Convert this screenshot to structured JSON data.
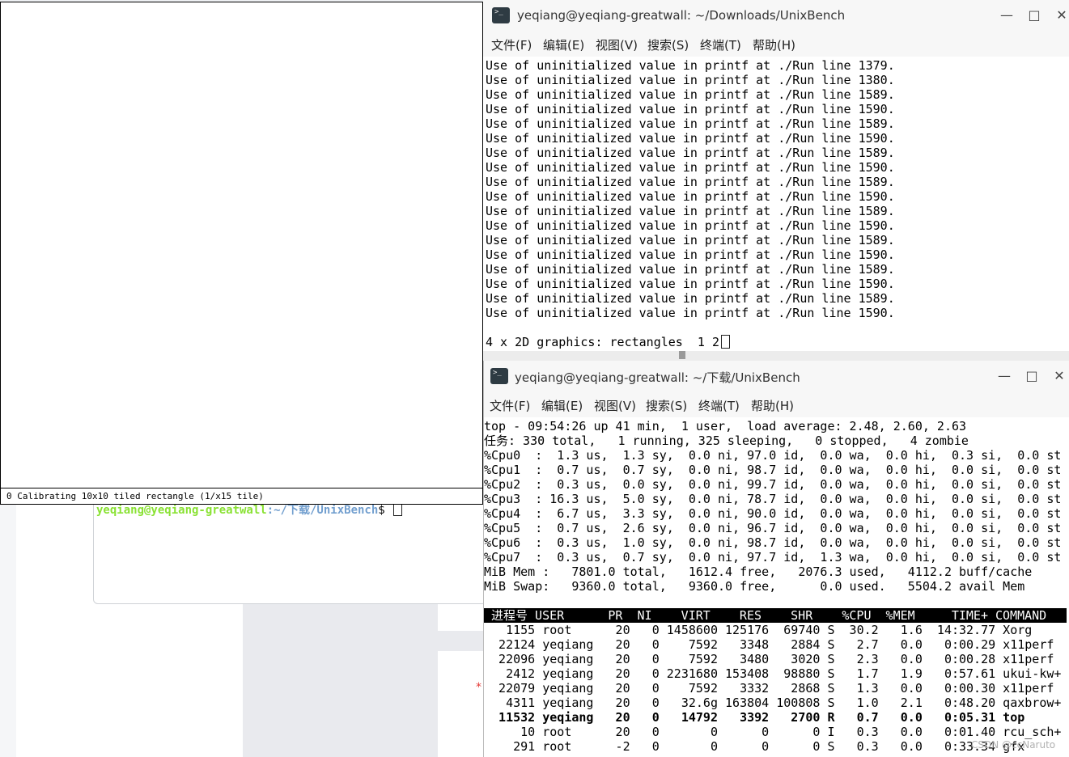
{
  "small_terminal": {
    "prompt_user": "yeqiang@yeqiang-greatwall",
    "prompt_path": ":~/下载/UnixBench",
    "prompt_symbol": "$ "
  },
  "x11perf": {
    "status_text": "0 Calibrating 10x10 tiled rectangle (1/x15 tile)"
  },
  "terminal_top": {
    "title": "yeqiang@yeqiang-greatwall: ~/Downloads/UnixBench",
    "menu": [
      "文件(F)",
      "编辑(E)",
      "视图(V)",
      "搜索(S)",
      "终端(T)",
      "帮助(H)"
    ],
    "lines": [
      "Use of uninitialized value in printf at ./Run line 1379.",
      "Use of uninitialized value in printf at ./Run line 1380.",
      "Use of uninitialized value in printf at ./Run line 1589.",
      "Use of uninitialized value in printf at ./Run line 1590.",
      "Use of uninitialized value in printf at ./Run line 1589.",
      "Use of uninitialized value in printf at ./Run line 1590.",
      "Use of uninitialized value in printf at ./Run line 1589.",
      "Use of uninitialized value in printf at ./Run line 1590.",
      "Use of uninitialized value in printf at ./Run line 1589.",
      "Use of uninitialized value in printf at ./Run line 1590.",
      "Use of uninitialized value in printf at ./Run line 1589.",
      "Use of uninitialized value in printf at ./Run line 1590.",
      "Use of uninitialized value in printf at ./Run line 1589.",
      "Use of uninitialized value in printf at ./Run line 1590.",
      "Use of uninitialized value in printf at ./Run line 1589.",
      "Use of uninitialized value in printf at ./Run line 1590.",
      "Use of uninitialized value in printf at ./Run line 1589.",
      "Use of uninitialized value in printf at ./Run line 1590.",
      "",
      "4 x 2D graphics: rectangles  1 2"
    ]
  },
  "terminal_bottom": {
    "title": "yeqiang@yeqiang-greatwall: ~/下载/UnixBench",
    "menu": [
      "文件(F)",
      "编辑(E)",
      "视图(V)",
      "搜索(S)",
      "终端(T)",
      "帮助(H)"
    ],
    "summary": [
      "top - 09:54:26 up 41 min,  1 user,  load average: 2.48, 2.60, 2.63",
      "任务: 330 total,   1 running, 325 sleeping,   0 stopped,   4 zombie",
      "%Cpu0  :  1.3 us,  1.3 sy,  0.0 ni, 97.0 id,  0.0 wa,  0.0 hi,  0.3 si,  0.0 st",
      "%Cpu1  :  0.7 us,  0.7 sy,  0.0 ni, 98.7 id,  0.0 wa,  0.0 hi,  0.0 si,  0.0 st",
      "%Cpu2  :  0.3 us,  0.0 sy,  0.0 ni, 99.7 id,  0.0 wa,  0.0 hi,  0.0 si,  0.0 st",
      "%Cpu3  : 16.3 us,  5.0 sy,  0.0 ni, 78.7 id,  0.0 wa,  0.0 hi,  0.0 si,  0.0 st",
      "%Cpu4  :  6.7 us,  3.3 sy,  0.0 ni, 90.0 id,  0.0 wa,  0.0 hi,  0.0 si,  0.0 st",
      "%Cpu5  :  0.7 us,  2.6 sy,  0.0 ni, 96.7 id,  0.0 wa,  0.0 hi,  0.0 si,  0.0 st",
      "%Cpu6  :  0.3 us,  1.0 sy,  0.0 ni, 98.7 id,  0.0 wa,  0.0 hi,  0.0 si,  0.0 st",
      "%Cpu7  :  0.3 us,  0.7 sy,  0.0 ni, 97.7 id,  1.3 wa,  0.0 hi,  0.0 si,  0.0 st",
      "MiB Mem :   7801.0 total,   1612.4 free,   2076.3 used,   4112.2 buff/cache",
      "MiB Swap:   9360.0 total,   9360.0 free,      0.0 used.   5504.2 avail Mem"
    ],
    "process_header": " 进程号 USER      PR  NI    VIRT    RES    SHR    %CPU  %MEM     TIME+ COMMAND",
    "processes": [
      "   1155 root      20   0 1458600 125176  69740 S  30.2   1.6  14:32.77 Xorg",
      "  22124 yeqiang   20   0    7592   3348   2884 S   2.7   0.0   0:00.29 x11perf",
      "  22096 yeqiang   20   0    7592   3480   3020 S   2.3   0.0   0:00.28 x11perf",
      "   2412 yeqiang   20   0 2231680 153408  98880 S   1.7   1.9   0:57.61 ukui-kw+",
      "  22079 yeqiang   20   0    7592   3332   2868 S   1.3   0.0   0:00.30 x11perf",
      "   4311 yeqiang   20   0   32.6g 163804 100808 S   1.0   2.1   0:48.20 qaxbrow+",
      "  11532 yeqiang   20   0   14792   3392   2700 R   0.7   0.0   0:05.31 top",
      "     10 root      20   0       0      0      0 I   0.3   0.0   0:01.40 rcu_sch+",
      "    291 root      -2   0       0      0      0 S   0.3   0.0   0:33.34 gfx"
    ],
    "bold_row_index": 6
  },
  "watermark": "CSDN @ccNaruto",
  "colors": {
    "prompt_user": "#8ae234",
    "prompt_path": "#729fcf",
    "header_bg": "#000000"
  }
}
